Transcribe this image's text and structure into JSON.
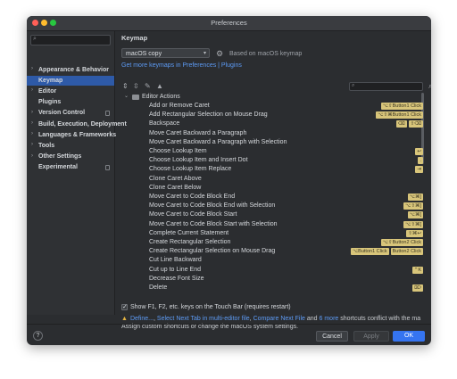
{
  "window": {
    "title": "Preferences"
  },
  "sidebar": {
    "search_placeholder": "",
    "items": [
      {
        "label": "Appearance & Behavior",
        "arrow": "›",
        "expandable": true,
        "selected": false
      },
      {
        "label": "Keymap",
        "arrow": "",
        "expandable": false,
        "selected": true
      },
      {
        "label": "Editor",
        "arrow": "›",
        "expandable": true,
        "selected": false
      },
      {
        "label": "Plugins",
        "arrow": "",
        "expandable": false,
        "selected": false
      },
      {
        "label": "Version Control",
        "arrow": "›",
        "expandable": true,
        "selected": false,
        "doc_icon": true
      },
      {
        "label": "Build, Execution, Deployment",
        "arrow": "›",
        "expandable": true,
        "selected": false
      },
      {
        "label": "Languages & Frameworks",
        "arrow": "›",
        "expandable": true,
        "selected": false
      },
      {
        "label": "Tools",
        "arrow": "›",
        "expandable": true,
        "selected": false
      },
      {
        "label": "Other Settings",
        "arrow": "›",
        "expandable": true,
        "selected": false
      },
      {
        "label": "Experimental",
        "arrow": "",
        "expandable": false,
        "selected": false,
        "doc_icon": true
      }
    ]
  },
  "main": {
    "heading": "Keymap",
    "keymap_select": "macOS copy",
    "based_on": "Based on macOS keymap",
    "more_link": "Get more keymaps in Preferences | Plugins",
    "category": "Editor Actions",
    "actions": [
      {
        "label": "Add or Remove Caret",
        "shortcuts": [
          "⌥⇧Button1 Click"
        ]
      },
      {
        "label": "Add Rectangular Selection on Mouse Drag",
        "shortcuts": [
          "⌥⇧⌘Button1 Click"
        ]
      },
      {
        "label": "Backspace",
        "shortcuts": [
          "⌫",
          "⇧⌫"
        ]
      },
      {
        "label": "Move Caret Backward a Paragraph",
        "shortcuts": []
      },
      {
        "label": "Move Caret Backward a Paragraph with Selection",
        "shortcuts": []
      },
      {
        "label": "Choose Lookup Item",
        "shortcuts": [
          "↩"
        ]
      },
      {
        "label": "Choose Lookup Item and Insert Dot",
        "shortcuts": [
          "."
        ]
      },
      {
        "label": "Choose Lookup Item Replace",
        "shortcuts": [
          "⇥"
        ]
      },
      {
        "label": "Clone Caret Above",
        "shortcuts": []
      },
      {
        "label": "Clone Caret Below",
        "shortcuts": []
      },
      {
        "label": "Move Caret to Code Block End",
        "shortcuts": [
          "⌥⌘]"
        ]
      },
      {
        "label": "Move Caret to Code Block End with Selection",
        "shortcuts": [
          "⌥⇧⌘]"
        ]
      },
      {
        "label": "Move Caret to Code Block Start",
        "shortcuts": [
          "⌥⌘["
        ]
      },
      {
        "label": "Move Caret to Code Block Start with Selection",
        "shortcuts": [
          "⌥⇧⌘["
        ]
      },
      {
        "label": "Complete Current Statement",
        "shortcuts": [
          "⇧⌘↩"
        ]
      },
      {
        "label": "Create Rectangular Selection",
        "shortcuts": [
          "⌥⇧Button2 Click"
        ]
      },
      {
        "label": "Create Rectangular Selection on Mouse Drag",
        "shortcuts": [
          "⌥Button1 Click",
          "Button2 Click"
        ]
      },
      {
        "label": "Cut Line Backward",
        "shortcuts": []
      },
      {
        "label": "Cut up to Line End",
        "shortcuts": [
          "⌃K"
        ]
      },
      {
        "label": "Decrease Font Size",
        "shortcuts": []
      },
      {
        "label": "Delete",
        "shortcuts": [
          "⌦"
        ]
      }
    ],
    "touchbar_checkbox": "Show F1, F2, etc. keys on the Touch Bar (requires restart)",
    "warning": {
      "link1": "Define...",
      "sep1": ",",
      "link2": "Select Next Tab in multi-editor file",
      "sep2": ",",
      "link3": "Compare Next File",
      "mid": " and ",
      "link4": "6 more",
      "tail": " shortcuts conflict with the ma",
      "line2": "Assign custom shortcuts or change the macOS system settings."
    }
  },
  "footer": {
    "help": "?",
    "cancel": "Cancel",
    "apply": "Apply",
    "ok": "OK"
  },
  "colors": {
    "accent": "#3574f0",
    "selection": "#2e5aa8",
    "shortcut_chip": "#d8c57a",
    "link": "#5d9bf5"
  }
}
